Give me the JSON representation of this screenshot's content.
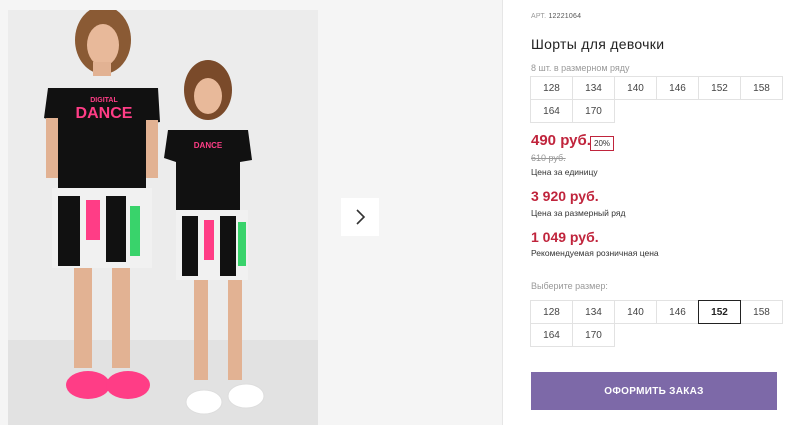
{
  "product": {
    "art_label": "АРТ.",
    "art_number": "12221064",
    "title": "Шорты для девочки",
    "pack_note": "8 шт. в размерном ряду",
    "pack_sizes": [
      "128",
      "134",
      "140",
      "146",
      "152",
      "158",
      "164",
      "170"
    ],
    "price": "490 руб.",
    "discount": "20%",
    "old_price": "610 руб.",
    "unit_price_label": "Цена за единицу",
    "pack_price": "3 920 руб.",
    "pack_price_label": "Цена за размерный ряд",
    "retail_price": "1 049 руб.",
    "retail_price_label": "Рекомендуемая розничная цена",
    "choose_size_label": "Выберите размер:",
    "size_options": [
      "128",
      "134",
      "140",
      "146",
      "152",
      "158",
      "164",
      "170"
    ],
    "selected_size": "152",
    "order_button": "ОФОРМИТЬ ЗАКАЗ"
  },
  "photo": {
    "shirt_print_top": "DIGITAL",
    "shirt_print_main": "DANCE"
  },
  "icons": {
    "next": "chevron-right-icon"
  },
  "colors": {
    "price": "#c0243c",
    "button": "#7d69a8",
    "shoes_pink": "#ff3d86"
  }
}
